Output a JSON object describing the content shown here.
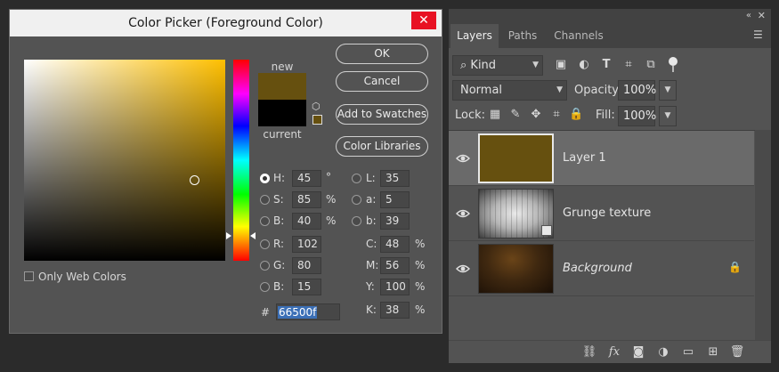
{
  "color_picker": {
    "title": "Color Picker (Foreground Color)",
    "close_icon": "close-icon",
    "new_label": "new",
    "current_label": "current",
    "new_color": "#66500f",
    "current_color": "#000000",
    "buttons": {
      "ok": "OK",
      "cancel": "Cancel",
      "add_to_swatches": "Add to Swatches",
      "color_libraries": "Color Libraries"
    },
    "fields": {
      "h": {
        "label": "H:",
        "value": "45",
        "unit": "°",
        "selected": true
      },
      "s": {
        "label": "S:",
        "value": "85",
        "unit": "%"
      },
      "b": {
        "label": "B:",
        "value": "40",
        "unit": "%"
      },
      "r": {
        "label": "R:",
        "value": "102"
      },
      "g": {
        "label": "G:",
        "value": "80"
      },
      "b2": {
        "label": "B:",
        "value": "15"
      },
      "l": {
        "label": "L:",
        "value": "35"
      },
      "a": {
        "label": "a:",
        "value": "5"
      },
      "lab_b": {
        "label": "b:",
        "value": "39"
      },
      "c": {
        "label": "C:",
        "value": "48",
        "unit": "%"
      },
      "m": {
        "label": "M:",
        "value": "56",
        "unit": "%"
      },
      "y": {
        "label": "Y:",
        "value": "100",
        "unit": "%"
      },
      "k": {
        "label": "K:",
        "value": "38",
        "unit": "%"
      }
    },
    "hex_prefix": "#",
    "hex_value": "66500f",
    "only_web_colors_label": "Only Web Colors",
    "only_web_colors_checked": false,
    "hue_degrees": 45,
    "saturation": 0.85,
    "brightness": 0.4
  },
  "layers_panel": {
    "tabs": [
      {
        "label": "Layers",
        "active": true
      },
      {
        "label": "Paths",
        "active": false
      },
      {
        "label": "Channels",
        "active": false
      }
    ],
    "kind_filter": {
      "icon": "search-icon",
      "label": "Kind"
    },
    "blend_mode": "Normal",
    "opacity_label": "Opacity:",
    "opacity_value": "100%",
    "lock_label": "Lock:",
    "fill_label": "Fill:",
    "fill_value": "100%",
    "layers": [
      {
        "name": "Layer 1",
        "selected": true,
        "visible": true,
        "color": "#66500f"
      },
      {
        "name": "Grunge texture",
        "selected": false,
        "visible": true,
        "smart_object": true
      },
      {
        "name": "Background",
        "selected": false,
        "visible": true,
        "locked": true,
        "italic": true
      }
    ],
    "bottom_icons": [
      "link-layers-icon",
      "fx-icon",
      "add-mask-icon",
      "adjustment-layer-icon",
      "new-group-icon",
      "new-layer-icon",
      "delete-icon"
    ]
  },
  "colors": {
    "dialog_bg": "#535353",
    "title_bg": "#f0f0f0",
    "close_red": "#e81123",
    "selection_blue": "#3b6fb6"
  }
}
